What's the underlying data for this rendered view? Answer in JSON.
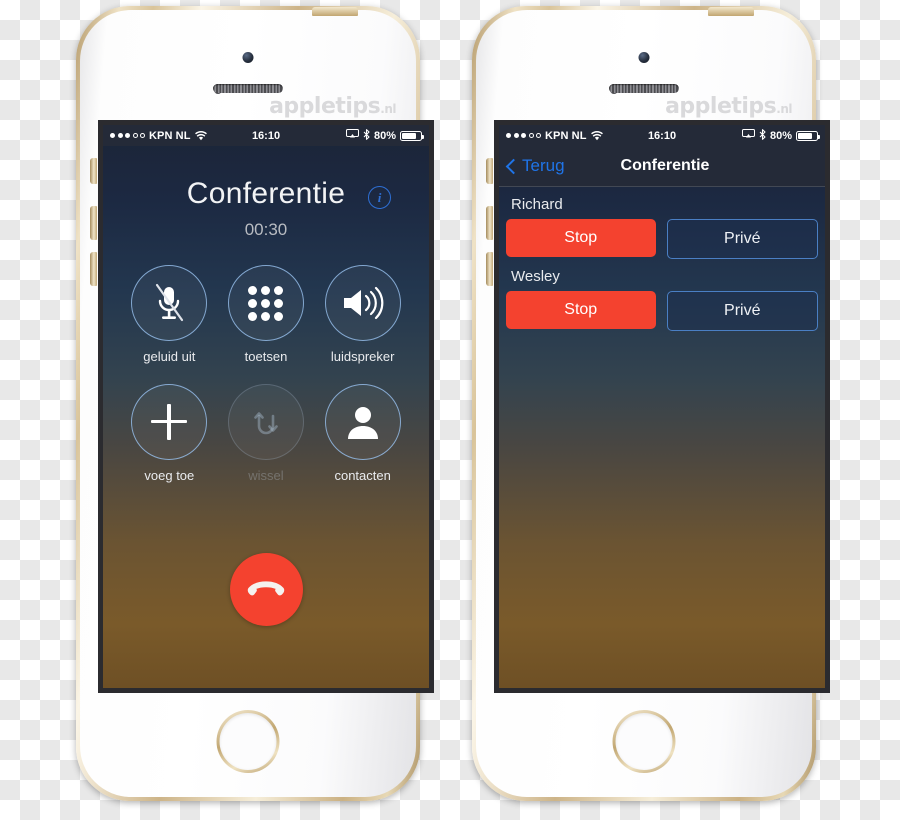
{
  "watermark": {
    "name": "appletips",
    "tld": ".nl"
  },
  "statusbar": {
    "signal_filled": 3,
    "signal_empty": 2,
    "carrier": "KPN NL",
    "wifi_icon": "wifi-icon",
    "time": "16:10",
    "airplay_icon": "airplay-icon",
    "bluetooth_icon": "bluetooth-icon",
    "battery_percent": "80%",
    "battery_icon": "battery-icon"
  },
  "left_phone": {
    "call": {
      "title": "Conferentie",
      "info_label": "i",
      "duration": "00:30"
    },
    "buttons": [
      {
        "label": "geluid uit",
        "icon": "microphone-off-icon",
        "disabled": false
      },
      {
        "label": "toetsen",
        "icon": "keypad-icon",
        "disabled": false
      },
      {
        "label": "luidspreker",
        "icon": "speaker-icon",
        "disabled": false
      },
      {
        "label": "voeg toe",
        "icon": "plus-icon",
        "disabled": false
      },
      {
        "label": "wissel",
        "icon": "swap-call-icon",
        "disabled": true
      },
      {
        "label": "contacten",
        "icon": "contacts-person-icon",
        "disabled": false
      }
    ],
    "end_call": {
      "icon": "end-call-handset-icon",
      "color": "#f4422f"
    }
  },
  "right_phone": {
    "nav": {
      "back_label": "Terug",
      "title": "Conferentie"
    },
    "participants": [
      {
        "name": "Richard",
        "stop_label": "Stop",
        "private_label": "Privé"
      },
      {
        "name": "Wesley",
        "stop_label": "Stop",
        "private_label": "Privé"
      }
    ]
  },
  "colors": {
    "accent_red": "#f4422f",
    "accent_blue": "#1f74e8",
    "outline_blue": "#4a7fc4",
    "statusbar_bg": "#242a38"
  }
}
